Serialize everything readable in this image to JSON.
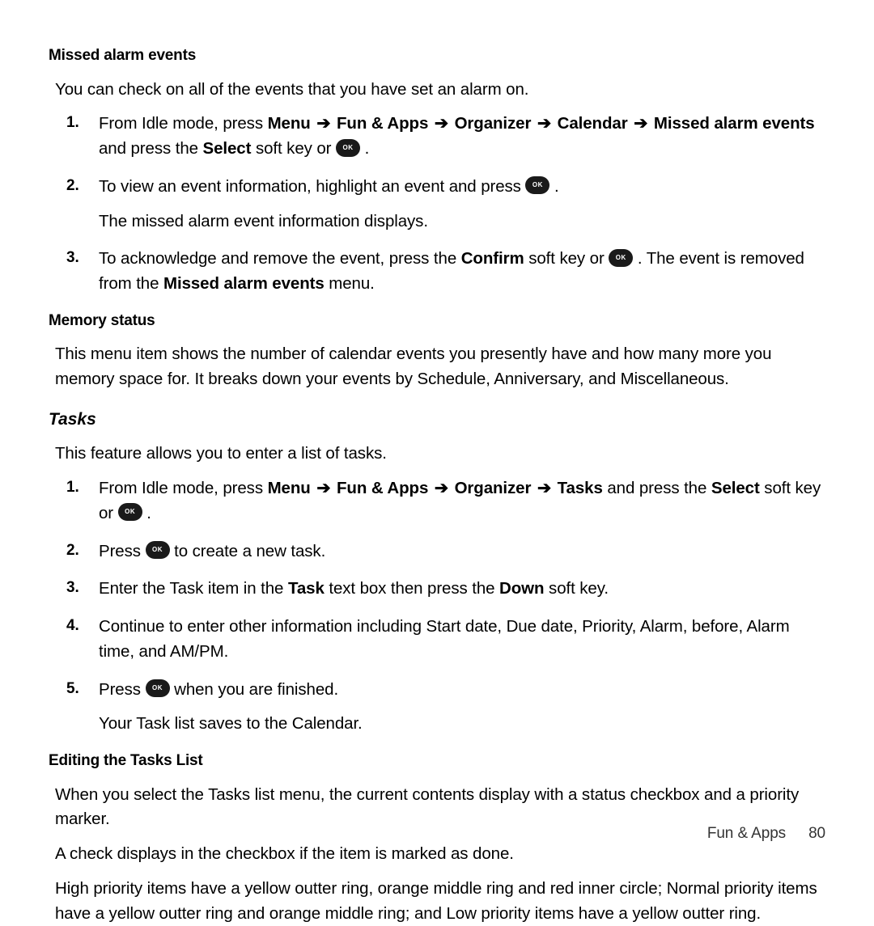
{
  "arrow": "➔",
  "sections": {
    "missed": {
      "heading": "Missed alarm events",
      "intro": "You can check on all of the events that you have set an alarm on.",
      "items": [
        {
          "p1a": "From Idle mode, press ",
          "menu": "Menu",
          "fun": "Fun & Apps",
          "org": "Organizer",
          "cal": "Calendar",
          "mist": "Missed alarm events",
          "p1b": " and press the ",
          "select": "Select",
          "p1c": " soft key or ",
          "p1d": "."
        },
        {
          "p2a": "To view an event information, highlight an event and press ",
          "p2b": ".",
          "p2c": "The missed alarm event information displays."
        },
        {
          "p3a": "To acknowledge and remove the event, press the ",
          "confirm": "Confirm",
          "p3b": " soft key or ",
          "p3c": ". The event is removed from the ",
          "maemenu": "Missed alarm events",
          "p3d": " menu."
        }
      ]
    },
    "memory": {
      "heading": "Memory status",
      "body": "This menu item shows the number of calendar events you presently have and how many more you memory space for. It breaks down your events by Schedule, Anniversary, and Miscellaneous."
    },
    "tasks": {
      "heading": "Tasks",
      "intro": "This feature allows you to enter a list of tasks.",
      "items": {
        "i1": {
          "a": "From Idle mode, press ",
          "menu": "Menu",
          "fun": "Fun & Apps",
          "org": "Organizer",
          "tasks": "Tasks",
          "b": " and press the ",
          "select": "Select",
          "c": " soft key or ",
          "d": "."
        },
        "i2": {
          "a": "Press ",
          "b": " to create a new task."
        },
        "i3": {
          "a": "Enter the Task item in the ",
          "task": "Task",
          "b": " text box then press the ",
          "down": "Down",
          "c": " soft key."
        },
        "i4": {
          "a": "Continue to enter other information including Start date, Due date, Priority, Alarm, before, Alarm time, and AM/PM."
        },
        "i5": {
          "a": "Press ",
          "b": " when you are finished.",
          "c": "Your Task list saves to the Calendar."
        }
      }
    },
    "editing": {
      "heading": "Editing the Tasks List",
      "p1": "When you select the Tasks list menu, the current contents display with a status checkbox and a priority marker.",
      "p2": "A check displays in the checkbox if the item is marked as done.",
      "p3": "High priority items have a yellow outter ring, orange middle ring and red inner circle; Normal priority items have a yellow outter ring and orange middle ring; and Low priority items have a yellow outter ring."
    }
  },
  "footer": {
    "section": "Fun & Apps",
    "page": "80"
  }
}
